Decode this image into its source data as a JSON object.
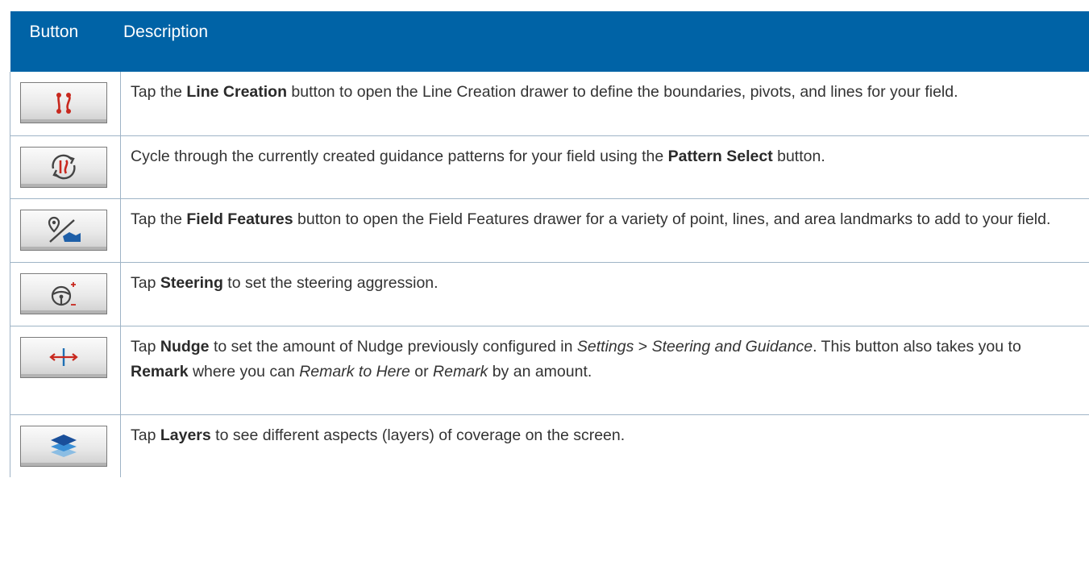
{
  "header": {
    "col1": "Button",
    "col2": "Description"
  },
  "rows": [
    {
      "icon": "line-creation-icon",
      "d": [
        {
          "t": "Tap the ",
          "s": "n"
        },
        {
          "t": "Line Creation",
          "s": "b"
        },
        {
          "t": " button to open the Line Creation drawer to define the boundaries, pivots, and lines for your field.",
          "s": "n"
        }
      ]
    },
    {
      "icon": "pattern-select-icon",
      "d": [
        {
          "t": "Cycle through the currently created guidance patterns for your field using the ",
          "s": "n"
        },
        {
          "t": "Pattern Select",
          "s": "b"
        },
        {
          "t": " button.",
          "s": "n"
        }
      ]
    },
    {
      "icon": "field-features-icon",
      "d": [
        {
          "t": "Tap the ",
          "s": "n"
        },
        {
          "t": "Field Features",
          "s": "b"
        },
        {
          "t": " button to open the Field Features drawer for a variety of point, lines, and area landmarks to add to your field.",
          "s": "n"
        }
      ]
    },
    {
      "icon": "steering-wheel-icon",
      "d": [
        {
          "t": "Tap ",
          "s": "n"
        },
        {
          "t": "Steering",
          "s": "b"
        },
        {
          "t": " to set the steering aggression.",
          "s": "n"
        }
      ]
    },
    {
      "icon": "nudge-icon",
      "d": [
        {
          "t": "Tap ",
          "s": "n"
        },
        {
          "t": "Nudge",
          "s": "b"
        },
        {
          "t": " to set the amount of Nudge previously configured in ",
          "s": "n"
        },
        {
          "t": "Settings",
          "s": "i"
        },
        {
          "t": " > ",
          "s": "n"
        },
        {
          "t": "Steering and Guidance",
          "s": "i"
        },
        {
          "t": ". This button also takes you to ",
          "s": "n"
        },
        {
          "t": "Remark",
          "s": "b"
        },
        {
          "t": " where you can ",
          "s": "n"
        },
        {
          "t": "Remark to Here",
          "s": "i"
        },
        {
          "t": " or ",
          "s": "n"
        },
        {
          "t": "Remark",
          "s": "i"
        },
        {
          "t": " by an amount.",
          "s": "n"
        }
      ]
    },
    {
      "icon": "layers-icon",
      "d": [
        {
          "t": "Tap ",
          "s": "n"
        },
        {
          "t": "Layers",
          "s": "b"
        },
        {
          "t": " to see different aspects (layers) of coverage on the screen.",
          "s": "n"
        }
      ]
    }
  ],
  "colors": {
    "header_bg": "#0063a6",
    "icon_red": "#c8281e",
    "icon_blue": "#1e6fb4"
  }
}
